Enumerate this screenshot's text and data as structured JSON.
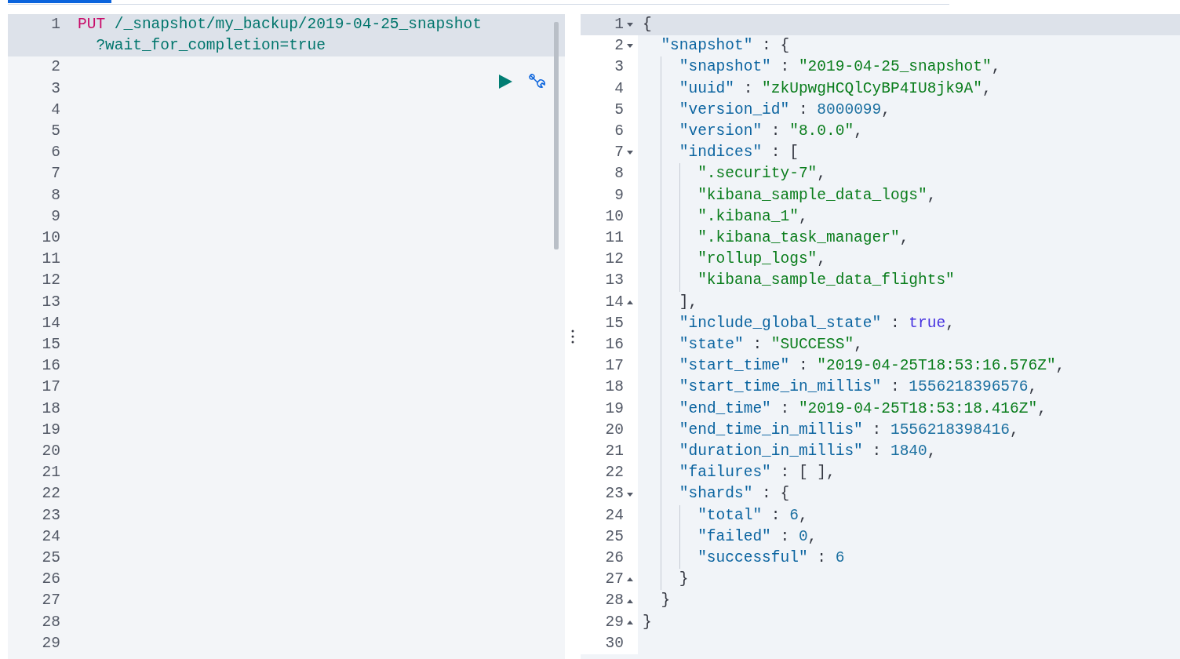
{
  "request_editor": {
    "lines": [
      {
        "number": "1",
        "active": true,
        "tokens": [
          {
            "kind": "method",
            "text": "PUT"
          },
          {
            "kind": "url",
            "text": " /_snapshot/my_backup/2019-04-25_snapshot"
          },
          {
            "kind": "url",
            "text": "?wait_for_completion=true"
          }
        ]
      },
      {
        "number": "2",
        "active": false
      },
      {
        "number": "3",
        "active": false
      },
      {
        "number": "4",
        "active": false
      },
      {
        "number": "5",
        "active": false
      },
      {
        "number": "6",
        "active": false
      },
      {
        "number": "7",
        "active": false
      },
      {
        "number": "8",
        "active": false
      },
      {
        "number": "9",
        "active": false
      },
      {
        "number": "10",
        "active": false
      },
      {
        "number": "11",
        "active": false
      },
      {
        "number": "12",
        "active": false
      },
      {
        "number": "13",
        "active": false
      },
      {
        "number": "14",
        "active": false
      },
      {
        "number": "15",
        "active": false
      },
      {
        "number": "16",
        "active": false
      },
      {
        "number": "17",
        "active": false
      },
      {
        "number": "18",
        "active": false
      },
      {
        "number": "19",
        "active": false
      },
      {
        "number": "20",
        "active": false
      },
      {
        "number": "21",
        "active": false
      },
      {
        "number": "22",
        "active": false
      },
      {
        "number": "23",
        "active": false
      },
      {
        "number": "24",
        "active": false
      },
      {
        "number": "25",
        "active": false
      },
      {
        "number": "26",
        "active": false
      },
      {
        "number": "27",
        "active": false
      },
      {
        "number": "28",
        "active": false
      },
      {
        "number": "29",
        "active": false
      }
    ]
  },
  "response_viewer": {
    "lines": [
      {
        "number": "1",
        "active": true,
        "kind": "opener",
        "tokens": [
          {
            "kind": "open",
            "text": "{"
          }
        ]
      },
      {
        "number": "2",
        "active": false,
        "kind": "opener",
        "tokens": [
          {
            "kind": "key",
            "text": "\"snapshot\""
          },
          {
            "kind": "punct",
            "text": " : "
          },
          {
            "kind": "open",
            "text": "{"
          }
        ]
      },
      {
        "number": "3",
        "active": false,
        "kind": "plain",
        "tokens": [
          {
            "kind": "key",
            "text": "\"snapshot\""
          },
          {
            "kind": "punct",
            "text": " : "
          },
          {
            "kind": "string",
            "text": "\"2019-04-25_snapshot\""
          },
          {
            "kind": "punct",
            "text": ","
          }
        ]
      },
      {
        "number": "4",
        "active": false,
        "kind": "plain",
        "tokens": [
          {
            "kind": "key",
            "text": "\"uuid\""
          },
          {
            "kind": "punct",
            "text": " : "
          },
          {
            "kind": "string",
            "text": "\"zkUpwgHCQlCyBP4IU8jk9A\""
          },
          {
            "kind": "punct",
            "text": ","
          }
        ]
      },
      {
        "number": "5",
        "active": false,
        "kind": "plain",
        "tokens": [
          {
            "kind": "key",
            "text": "\"version_id\""
          },
          {
            "kind": "punct",
            "text": " : "
          },
          {
            "kind": "number",
            "text": "8000099"
          },
          {
            "kind": "punct",
            "text": ","
          }
        ]
      },
      {
        "number": "6",
        "active": false,
        "kind": "plain",
        "tokens": [
          {
            "kind": "key",
            "text": "\"version\""
          },
          {
            "kind": "punct",
            "text": " : "
          },
          {
            "kind": "string",
            "text": "\"8.0.0\""
          },
          {
            "kind": "punct",
            "text": ","
          }
        ]
      },
      {
        "number": "7",
        "active": false,
        "kind": "opener",
        "tokens": [
          {
            "kind": "key",
            "text": "\"indices\""
          },
          {
            "kind": "punct",
            "text": " : "
          },
          {
            "kind": "open",
            "text": "["
          }
        ]
      },
      {
        "number": "8",
        "active": false,
        "kind": "plain",
        "tokens": [
          {
            "kind": "string",
            "text": "\".security-7\""
          },
          {
            "kind": "punct",
            "text": ","
          }
        ]
      },
      {
        "number": "9",
        "active": false,
        "kind": "plain",
        "tokens": [
          {
            "kind": "string",
            "text": "\"kibana_sample_data_logs\""
          },
          {
            "kind": "punct",
            "text": ","
          }
        ]
      },
      {
        "number": "10",
        "active": false,
        "kind": "plain",
        "tokens": [
          {
            "kind": "string",
            "text": "\".kibana_1\""
          },
          {
            "kind": "punct",
            "text": ","
          }
        ]
      },
      {
        "number": "11",
        "active": false,
        "kind": "plain",
        "tokens": [
          {
            "kind": "string",
            "text": "\".kibana_task_manager\""
          },
          {
            "kind": "punct",
            "text": ","
          }
        ]
      },
      {
        "number": "12",
        "active": false,
        "kind": "plain",
        "tokens": [
          {
            "kind": "string",
            "text": "\"rollup_logs\""
          },
          {
            "kind": "punct",
            "text": ","
          }
        ]
      },
      {
        "number": "13",
        "active": false,
        "kind": "plain",
        "tokens": [
          {
            "kind": "string",
            "text": "\"kibana_sample_data_flights\""
          }
        ]
      },
      {
        "number": "14",
        "active": false,
        "kind": "closer",
        "tokens": [
          {
            "kind": "close",
            "text": "]"
          },
          {
            "kind": "punct",
            "text": ","
          }
        ]
      },
      {
        "number": "15",
        "active": false,
        "kind": "plain",
        "tokens": [
          {
            "kind": "key",
            "text": "\"include_global_state\""
          },
          {
            "kind": "punct",
            "text": " : "
          },
          {
            "kind": "boolean",
            "text": "true"
          },
          {
            "kind": "punct",
            "text": ","
          }
        ]
      },
      {
        "number": "16",
        "active": false,
        "kind": "plain",
        "tokens": [
          {
            "kind": "key",
            "text": "\"state\""
          },
          {
            "kind": "punct",
            "text": " : "
          },
          {
            "kind": "string",
            "text": "\"SUCCESS\""
          },
          {
            "kind": "punct",
            "text": ","
          }
        ]
      },
      {
        "number": "17",
        "active": false,
        "kind": "plain",
        "tokens": [
          {
            "kind": "key",
            "text": "\"start_time\""
          },
          {
            "kind": "punct",
            "text": " : "
          },
          {
            "kind": "string",
            "text": "\"2019-04-25T18:53:16.576Z\""
          },
          {
            "kind": "punct",
            "text": ","
          }
        ]
      },
      {
        "number": "18",
        "active": false,
        "kind": "plain",
        "tokens": [
          {
            "kind": "key",
            "text": "\"start_time_in_millis\""
          },
          {
            "kind": "punct",
            "text": " : "
          },
          {
            "kind": "number",
            "text": "1556218396576"
          },
          {
            "kind": "punct",
            "text": ","
          }
        ]
      },
      {
        "number": "19",
        "active": false,
        "kind": "plain",
        "tokens": [
          {
            "kind": "key",
            "text": "\"end_time\""
          },
          {
            "kind": "punct",
            "text": " : "
          },
          {
            "kind": "string",
            "text": "\"2019-04-25T18:53:18.416Z\""
          },
          {
            "kind": "punct",
            "text": ","
          }
        ]
      },
      {
        "number": "20",
        "active": false,
        "kind": "plain",
        "tokens": [
          {
            "kind": "key",
            "text": "\"end_time_in_millis\""
          },
          {
            "kind": "punct",
            "text": " : "
          },
          {
            "kind": "number",
            "text": "1556218398416"
          },
          {
            "kind": "punct",
            "text": ","
          }
        ]
      },
      {
        "number": "21",
        "active": false,
        "kind": "plain",
        "tokens": [
          {
            "kind": "key",
            "text": "\"duration_in_millis\""
          },
          {
            "kind": "punct",
            "text": " : "
          },
          {
            "kind": "number",
            "text": "1840"
          },
          {
            "kind": "punct",
            "text": ","
          }
        ]
      },
      {
        "number": "22",
        "active": false,
        "kind": "plain",
        "tokens": [
          {
            "kind": "key",
            "text": "\"failures\""
          },
          {
            "kind": "punct",
            "text": " : "
          },
          {
            "kind": "open",
            "text": "["
          },
          {
            "kind": "close",
            "text": " ]"
          },
          {
            "kind": "punct",
            "text": ","
          }
        ]
      },
      {
        "number": "23",
        "active": false,
        "kind": "opener",
        "tokens": [
          {
            "kind": "key",
            "text": "\"shards\""
          },
          {
            "kind": "punct",
            "text": " : "
          },
          {
            "kind": "open",
            "text": "{"
          }
        ]
      },
      {
        "number": "24",
        "active": false,
        "kind": "plain",
        "tokens": [
          {
            "kind": "key",
            "text": "\"total\""
          },
          {
            "kind": "punct",
            "text": " : "
          },
          {
            "kind": "number",
            "text": "6"
          },
          {
            "kind": "punct",
            "text": ","
          }
        ]
      },
      {
        "number": "25",
        "active": false,
        "kind": "plain",
        "tokens": [
          {
            "kind": "key",
            "text": "\"failed\""
          },
          {
            "kind": "punct",
            "text": " : "
          },
          {
            "kind": "number",
            "text": "0"
          },
          {
            "kind": "punct",
            "text": ","
          }
        ]
      },
      {
        "number": "26",
        "active": false,
        "kind": "plain",
        "tokens": [
          {
            "kind": "key",
            "text": "\"successful\""
          },
          {
            "kind": "punct",
            "text": " : "
          },
          {
            "kind": "number",
            "text": "6"
          }
        ]
      },
      {
        "number": "27",
        "active": false,
        "kind": "closer",
        "tokens": [
          {
            "kind": "close",
            "text": "}"
          }
        ]
      },
      {
        "number": "28",
        "active": false,
        "kind": "closer",
        "tokens": [
          {
            "kind": "close",
            "text": "}"
          }
        ]
      },
      {
        "number": "29",
        "active": false,
        "kind": "closer",
        "tokens": [
          {
            "kind": "close",
            "text": "}"
          }
        ]
      },
      {
        "number": "30",
        "active": false,
        "kind": "plain"
      }
    ]
  }
}
